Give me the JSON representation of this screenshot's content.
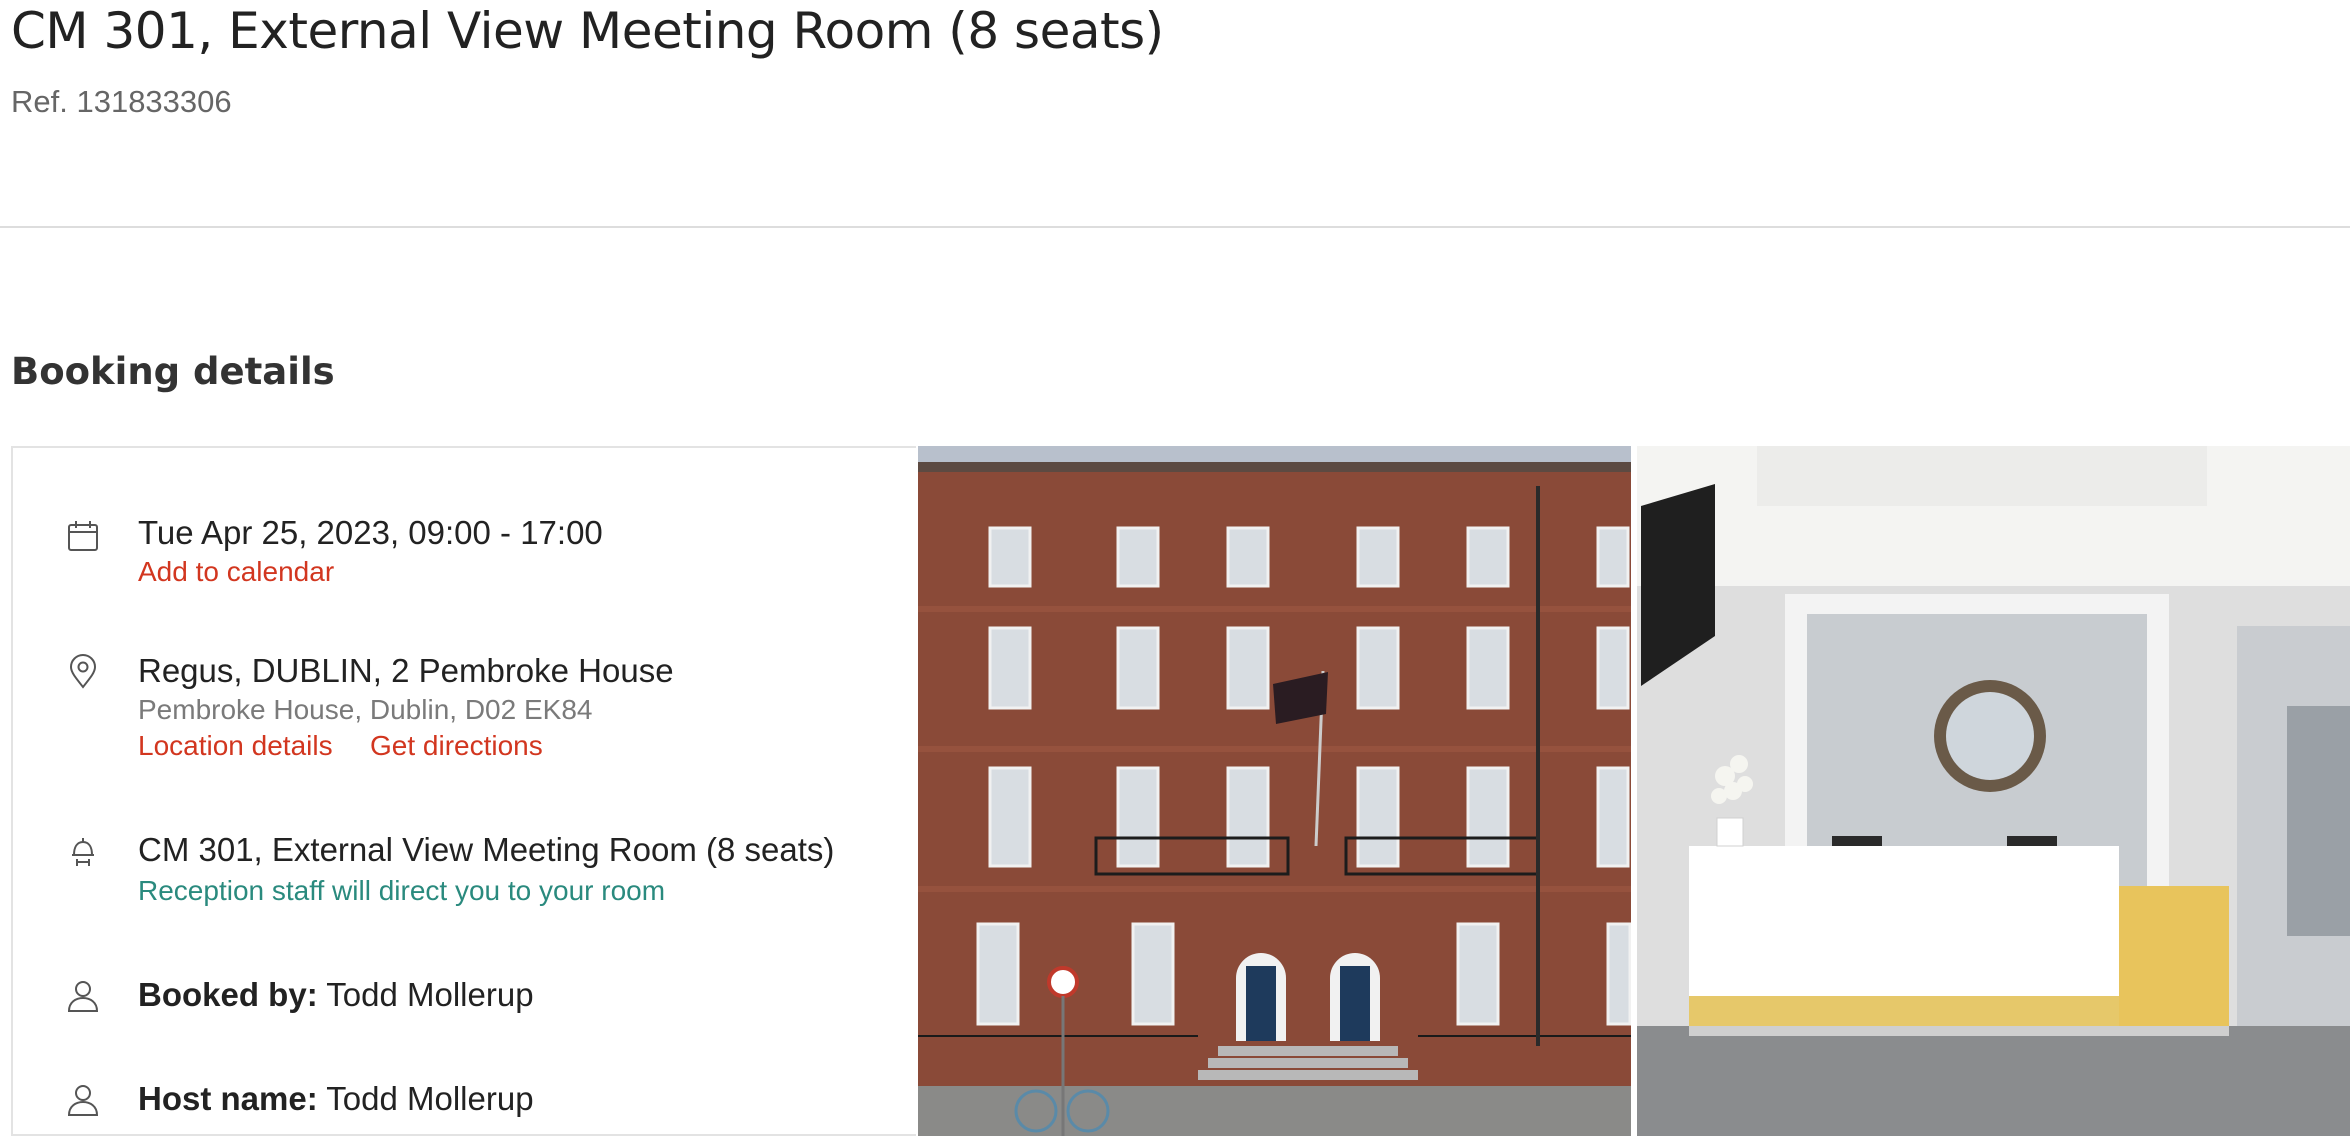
{
  "header": {
    "title": "CM 301, External View Meeting Room (8 seats)",
    "ref": "Ref. 131833306"
  },
  "booking": {
    "section_title": "Booking details",
    "datetime": "Tue Apr 25, 2023, 09:00 - 17:00",
    "add_to_calendar": "Add to calendar",
    "location_name": "Regus, DUBLIN, 2 Pembroke House",
    "location_address": "Pembroke House, Dublin, D02 EK84",
    "location_details": "Location details",
    "get_directions": "Get directions",
    "room_name": "CM 301, External View Meeting Room (8 seats)",
    "room_note": "Reception staff will direct you to your room",
    "booked_by_label": "Booked by:",
    "booked_by_value": "Todd Mollerup",
    "host_label": "Host name:",
    "host_value": "Todd Mollerup"
  },
  "icons": {
    "calendar": "calendar-icon",
    "location": "location-pin-icon",
    "room": "desk-bell-icon",
    "booked_by": "user-icon",
    "host": "user-icon"
  },
  "colors": {
    "link": "#d2361f",
    "note": "#2a8a7e",
    "text": "#222222",
    "muted": "#7a7a7a"
  }
}
